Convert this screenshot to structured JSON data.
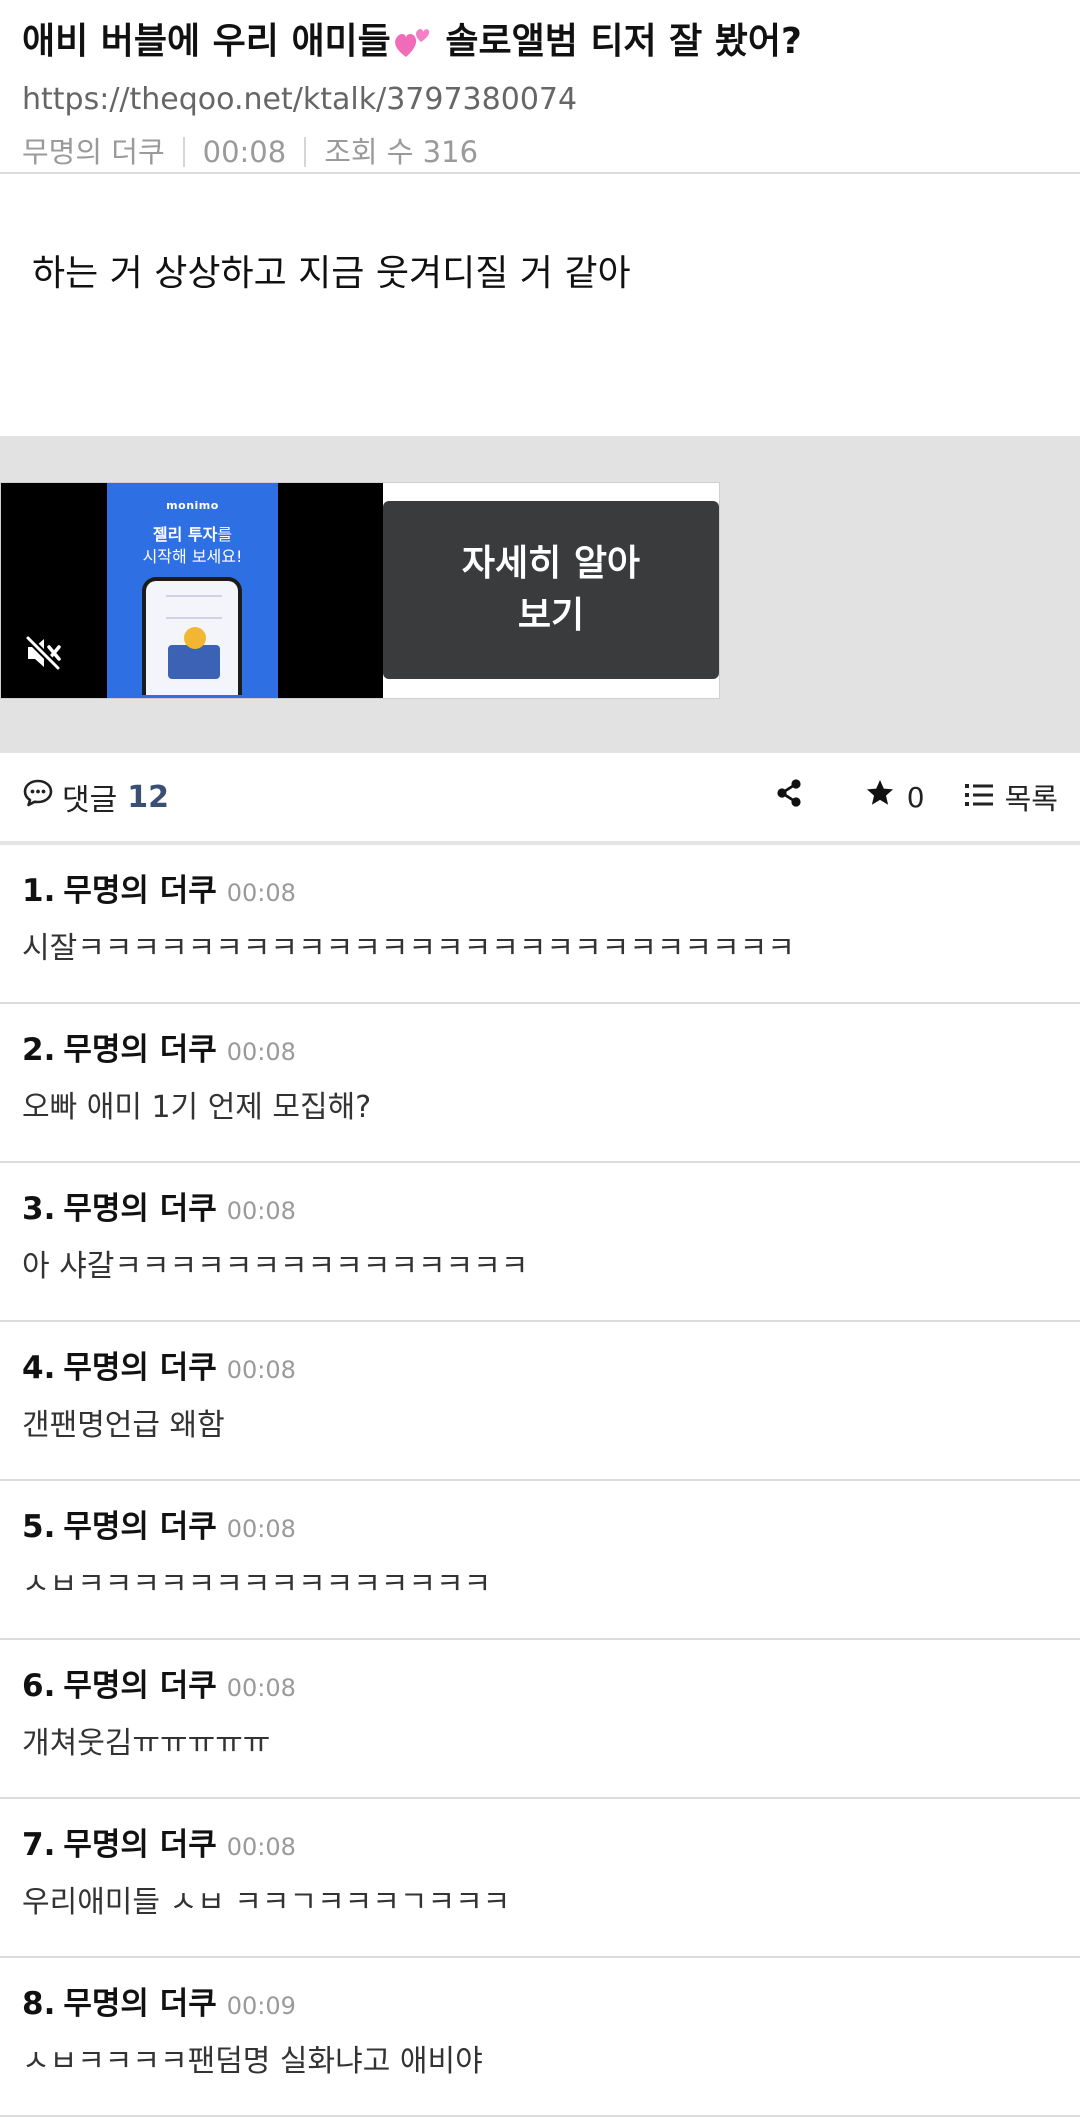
{
  "post": {
    "title_before": "애비 버블에 우리 애미들",
    "title_emoji": "two-hearts-emoji",
    "title_after": " 솔로앨범 티저 잘 봤어?",
    "url": "https://theqoo.net/ktalk/3797380074",
    "author": "무명의 더쿠",
    "time": "00:08",
    "views": "조회 수 316",
    "body": "하는 거 상상하고 지금 웃겨디질 거 같아"
  },
  "ad": {
    "brand": "monimo",
    "headline_bold": "젤리 투자",
    "headline_rest": "를",
    "headline_line2": "시작해 보세요!",
    "cta": "자세히 알아\n보기",
    "mute_icon": "mute-icon",
    "colors": {
      "cta_bg": "#3a3b3d",
      "creative_bg": "#2f6fe4",
      "area_bg": "#e2e2e2"
    }
  },
  "toolbar": {
    "comments_label": "댓글",
    "comments_count": "12",
    "star_count": "0",
    "list_label": "목록",
    "icons": [
      "comment-bubble-icon",
      "share-icon",
      "star-icon",
      "list-icon"
    ]
  },
  "comments": [
    {
      "num": "1.",
      "author": "무명의 더쿠",
      "time": "00:08",
      "text": "시잘ㅋㅋㅋㅋㅋㅋㅋㅋㅋㅋㅋㅋㅋㅋㅋㅋㅋㅋㅋㅋㅋㅋㅋㅋㅋㅋ"
    },
    {
      "num": "2.",
      "author": "무명의 더쿠",
      "time": "00:08",
      "text": "오빠 애미 1기 언제 모집해?"
    },
    {
      "num": "3.",
      "author": "무명의 더쿠",
      "time": "00:08",
      "text": "아 샤갈ㅋㅋㅋㅋㅋㅋㅋㅋㅋㅋㅋㅋㅋㅋㅋ"
    },
    {
      "num": "4.",
      "author": "무명의 더쿠",
      "time": "00:08",
      "text": "갠팬명언급 왜함"
    },
    {
      "num": "5.",
      "author": "무명의 더쿠",
      "time": "00:08",
      "text": "ㅅㅂㅋㅋㅋㅋㅋㅋㅋㅋㅋㅋㅋㅋㅋㅋㅋ"
    },
    {
      "num": "6.",
      "author": "무명의 더쿠",
      "time": "00:08",
      "text": "개쳐웃김ㅠㅠㅠㅠㅠ"
    },
    {
      "num": "7.",
      "author": "무명의 더쿠",
      "time": "00:08",
      "text": "우리애미들 ㅅㅂ ㅋㅋㄱㅋㅋㅋㄱㅋㅋㅋ"
    },
    {
      "num": "8.",
      "author": "무명의 더쿠",
      "time": "00:09",
      "text": "ㅅㅂㅋㅋㅋㅋ팬덤명 실화냐고 애비야"
    }
  ]
}
